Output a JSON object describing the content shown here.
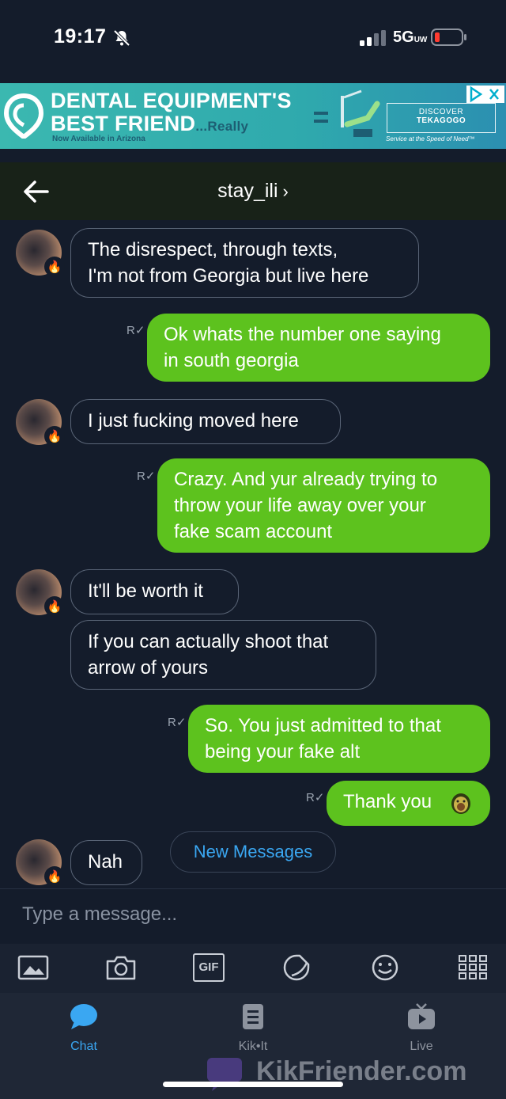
{
  "status_bar": {
    "time": "19:17",
    "network": "5G",
    "network_sup": "UW"
  },
  "ad": {
    "line1": "DENTAL EQUIPMENT'S",
    "line2": "BEST FRIEND",
    "line2_suffix": "...Really",
    "sub": "Now Available in Arizona",
    "box_top": "DISCOVER",
    "box_bottom": "TEKAGOGO",
    "tagline": "Service at the Speed of Need™"
  },
  "header": {
    "title": "stay_ili"
  },
  "messages": [
    {
      "direction": "in",
      "text_l1": "The disrespect, through texts,",
      "text_l2": "I'm not from Georgia but live here"
    },
    {
      "direction": "out",
      "text_l1": "Ok whats the number one saying",
      "text_l2": "in south georgia"
    },
    {
      "direction": "in",
      "text_l1": "I just fucking moved here"
    },
    {
      "direction": "out",
      "text_l1": "Crazy. And yur already trying to",
      "text_l2": "throw your life away over your",
      "text_l3": "fake scam account"
    },
    {
      "direction": "in",
      "text_l1": "It'll be worth it"
    },
    {
      "direction": "in",
      "text_l1": "If you can actually shoot that",
      "text_l2": "arrow of yours"
    },
    {
      "direction": "out",
      "text_l1": "So. You just admitted to that",
      "text_l2": "being your fake alt"
    },
    {
      "direction": "out",
      "text_l1": "Thank you"
    },
    {
      "direction": "in",
      "text_l1": "Nah"
    }
  ],
  "new_messages_label": "New Messages",
  "composer": {
    "placeholder": "Type a message..."
  },
  "toolbar": {
    "gif_label": "GIF"
  },
  "tabs": [
    {
      "label": "Chat",
      "active": true,
      "color": "#3aa7f2"
    },
    {
      "label": "Kik•It",
      "active": false
    },
    {
      "label": "Live",
      "active": false
    }
  ],
  "watermark": "KikFriender.com",
  "colors": {
    "background": "#141c2b",
    "outgoing_bubble": "#5dc21e",
    "accent": "#3aa7f2"
  }
}
